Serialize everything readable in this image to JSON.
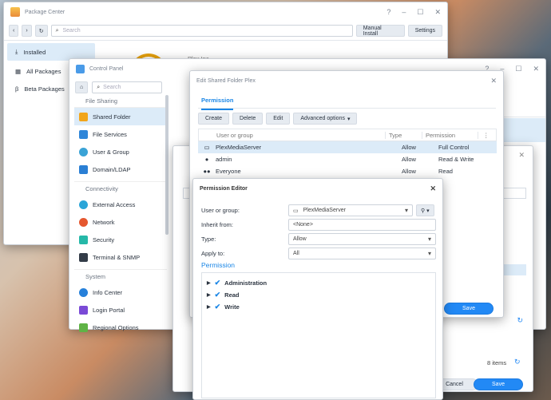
{
  "package_center": {
    "title": "Package Center",
    "search_placeholder": "Search",
    "manual_install": "Manual Install",
    "settings": "Settings",
    "nav": [
      "Installed",
      "All Packages",
      "Beta Packages"
    ],
    "publisher": "Plex Inc."
  },
  "control_panel": {
    "title": "Control Panel",
    "search_placeholder": "Search",
    "sections": [
      {
        "label": "File Sharing",
        "items": [
          "Shared Folder",
          "File Services",
          "User & Group",
          "Domain/LDAP"
        ]
      },
      {
        "label": "Connectivity",
        "items": [
          "External Access",
          "Network",
          "Security",
          "Terminal & SNMP"
        ]
      },
      {
        "label": "System",
        "items": [
          "Info Center",
          "Login Portal",
          "Regional Options"
        ]
      }
    ]
  },
  "edit_shared_folder": {
    "title": "Edit Shared Folder Plex",
    "tab": "Permission",
    "toolbar": [
      "Create",
      "Delete",
      "Edit",
      "Advanced options"
    ],
    "columns": [
      "User or group",
      "Type",
      "Permission"
    ],
    "rows": [
      {
        "name": "PlexMediaServer",
        "type": "Allow",
        "permission": "Full Control"
      },
      {
        "name": "admin",
        "type": "Allow",
        "permission": "Read & Write"
      },
      {
        "name": "Everyone",
        "type": "Allow",
        "permission": "Read"
      }
    ],
    "save": "Save"
  },
  "background_dialog": {
    "items_count": "8 items",
    "cancel": "Cancel",
    "save": "Save"
  },
  "permission_editor": {
    "title": "Permission Editor",
    "user_label": "User or group:",
    "user_value": "PlexMediaServer",
    "inherit_label": "Inherit from:",
    "inherit_value": "<None>",
    "type_label": "Type:",
    "type_value": "Allow",
    "apply_label": "Apply to:",
    "apply_value": "All",
    "section": "Permission",
    "tree": [
      "Administration",
      "Read",
      "Write"
    ]
  },
  "colors": {
    "accent": "#2289f5",
    "selected_row": "#dcebf8"
  }
}
